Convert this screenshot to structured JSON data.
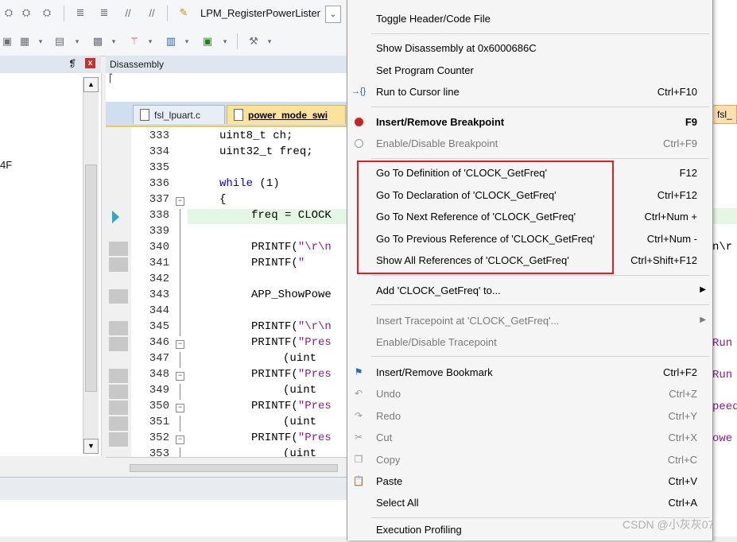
{
  "toolbar": {
    "function_dropdown_value": "LPM_RegisterPowerLister"
  },
  "left_pane": {
    "pin_glyph": "❡",
    "close_glyph": "x",
    "text_fragment": "4F"
  },
  "disassembly": {
    "title": "Disassembly"
  },
  "tabs": [
    {
      "label": "fsl_lpuart.c"
    },
    {
      "label": "power_mode_swi"
    }
  ],
  "editor": {
    "lines": [
      {
        "num": "333",
        "code": "uint8_t ch;"
      },
      {
        "num": "334",
        "code": "uint32_t freq;"
      },
      {
        "num": "335",
        "code": ""
      },
      {
        "num": "336",
        "kw": "while",
        "code": " (1)"
      },
      {
        "num": "337",
        "code": "{"
      },
      {
        "num": "338",
        "code": "freq = CLOCK"
      },
      {
        "num": "339",
        "code": ""
      },
      {
        "num": "340",
        "code": "PRINTF(",
        "str": "\"\\r\\n"
      },
      {
        "num": "341",
        "code": "PRINTF(",
        "str": "\""
      },
      {
        "num": "342",
        "code": ""
      },
      {
        "num": "343",
        "code": "APP_ShowPowe"
      },
      {
        "num": "344",
        "code": ""
      },
      {
        "num": "345",
        "code": "PRINTF(",
        "str": "\"\\r\\n"
      },
      {
        "num": "346",
        "code": "PRINTF(",
        "str": "\"Pres"
      },
      {
        "num": "347",
        "code": "(uint"
      },
      {
        "num": "348",
        "code": "PRINTF(",
        "str": "\"Pres"
      },
      {
        "num": "349",
        "code": "(uint"
      },
      {
        "num": "350",
        "code": "PRINTF(",
        "str": "\"Pres"
      },
      {
        "num": "351",
        "code": "(uint"
      },
      {
        "num": "352",
        "code": "PRINTF(",
        "str": "\"Pres"
      },
      {
        "num": "353",
        "code": "(uint"
      }
    ]
  },
  "right_fragments": {
    "tab_label": "fsl_",
    "frag1": "n\\r",
    "frag2": "Run",
    "frag3": "Run",
    "frag4": "peed",
    "frag5": "owe"
  },
  "context_menu": {
    "items": {
      "toggle_header": {
        "label": "Toggle Header/Code File"
      },
      "show_disassembly": {
        "label": "Show Disassembly at 0x6000686C"
      },
      "set_pc": {
        "label": "Set Program Counter"
      },
      "run_to_cursor": {
        "label": "Run to Cursor line",
        "shortcut": "Ctrl+F10"
      },
      "insert_breakpoint": {
        "label": "Insert/Remove Breakpoint",
        "shortcut": "F9"
      },
      "enable_breakpoint": {
        "label": "Enable/Disable Breakpoint",
        "shortcut": "Ctrl+F9"
      },
      "goto_definition": {
        "label": "Go To Definition of 'CLOCK_GetFreq'",
        "shortcut": "F12"
      },
      "goto_declaration": {
        "label": "Go To Declaration of 'CLOCK_GetFreq'",
        "shortcut": "Ctrl+F12"
      },
      "goto_next_ref": {
        "label": "Go To Next Reference of 'CLOCK_GetFreq'",
        "shortcut": "Ctrl+Num +"
      },
      "goto_prev_ref": {
        "label": "Go To Previous Reference of 'CLOCK_GetFreq'",
        "shortcut": "Ctrl+Num -"
      },
      "show_all_refs": {
        "label": "Show All References of 'CLOCK_GetFreq'",
        "shortcut": "Ctrl+Shift+F12"
      },
      "add_to": {
        "label": "Add 'CLOCK_GetFreq' to..."
      },
      "insert_tracepoint": {
        "label": "Insert Tracepoint at 'CLOCK_GetFreq'..."
      },
      "enable_tracepoint": {
        "label": "Enable/Disable Tracepoint"
      },
      "insert_bookmark": {
        "label": "Insert/Remove Bookmark",
        "shortcut": "Ctrl+F2"
      },
      "undo": {
        "label": "Undo",
        "shortcut": "Ctrl+Z"
      },
      "redo": {
        "label": "Redo",
        "shortcut": "Ctrl+Y"
      },
      "cut": {
        "label": "Cut",
        "shortcut": "Ctrl+X"
      },
      "copy": {
        "label": "Copy",
        "shortcut": "Ctrl+C"
      },
      "paste": {
        "label": "Paste",
        "shortcut": "Ctrl+V"
      },
      "select_all": {
        "label": "Select All",
        "shortcut": "Ctrl+A"
      },
      "execution_profiling": {
        "label": "Execution Profiling"
      }
    }
  },
  "colors": {
    "highlight_box": "#e02020",
    "breakpoint": "#cc2222",
    "keyword": "#0000ff",
    "string": "#8b1a8b",
    "active_tab": "#fbe39c"
  },
  "watermark": "CSDN @小灰灰07"
}
